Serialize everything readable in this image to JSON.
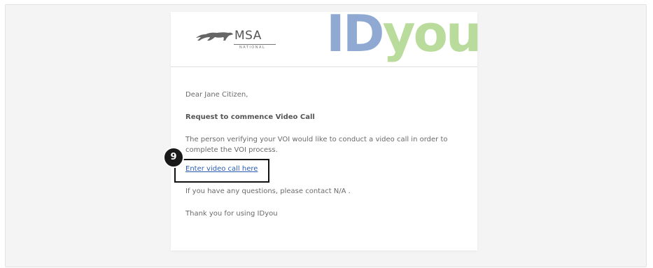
{
  "brand": {
    "msa_name": "MSA",
    "msa_subtitle": "NATIONAL",
    "idyou_id": "ID",
    "idyou_you": "you"
  },
  "email": {
    "greeting": "Dear Jane Citizen,",
    "subject": "Request to commence Video Call",
    "paragraph": "The person verifying your VOI would like to conduct a video call in order to complete the VOI process.",
    "cta_label": "Enter video call here",
    "questions": "If you have any questions, please contact N/A .",
    "thanks": "Thank you for using IDyou"
  },
  "annotation": {
    "step_number": "9"
  },
  "colors": {
    "id_blue": "#8fa9d2",
    "you_green": "#b9dc9d",
    "link_blue": "#2a5db0"
  },
  "icons": {
    "msa_logo": "panther-icon"
  }
}
